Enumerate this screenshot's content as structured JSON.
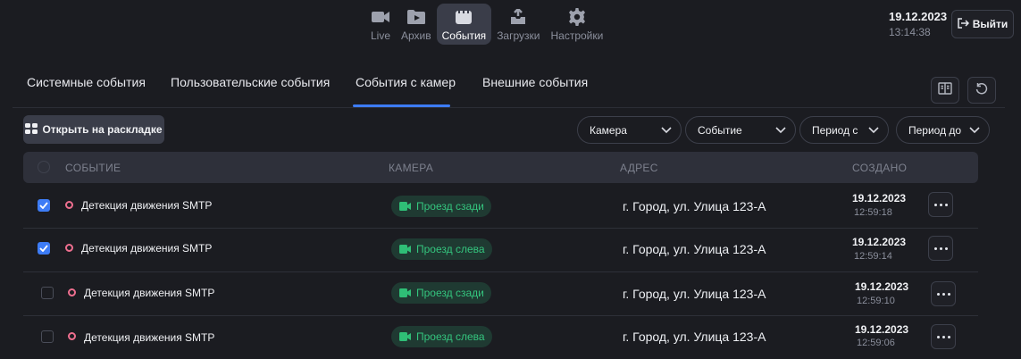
{
  "nav": {
    "items": [
      {
        "label": "Live",
        "icon": "camera-icon"
      },
      {
        "label": "Архив",
        "icon": "archive-folder-icon"
      },
      {
        "label": "События",
        "icon": "events-clapper-icon"
      },
      {
        "label": "Загрузки",
        "icon": "download-tray-icon"
      },
      {
        "label": "Настройки",
        "icon": "gear-icon"
      }
    ],
    "active_index": 2
  },
  "header": {
    "date": "19.12.2023",
    "time": "13:14:38",
    "logout_label": "Выйти"
  },
  "tabs": {
    "items": [
      "Системные события",
      "Пользовательские события",
      "События с камер",
      "Внешние события"
    ],
    "active_index": 2
  },
  "toolbar": {
    "open_layout_label": "Открыть на раскладке",
    "filters": {
      "camera": "Камера",
      "event": "Событие",
      "period_from": "Период с",
      "period_to": "Период до"
    }
  },
  "table": {
    "columns": {
      "event": "СОБЫТИЕ",
      "camera": "КАМЕРА",
      "address": "АДРЕС",
      "created": "СОЗДАНО"
    },
    "rows": [
      {
        "checked": true,
        "event": "Детекция движения SMTP",
        "camera": "Проезд сзади",
        "address": "г. Город, ул. Улица 123-А",
        "date": "19.12.2023",
        "time": "12:59:18"
      },
      {
        "checked": true,
        "event": "Детекция движения SMTP",
        "camera": "Проезд слева",
        "address": "г. Город, ул. Улица 123-А",
        "date": "19.12.2023",
        "time": "12:59:14"
      },
      {
        "checked": false,
        "event": "Детекция движения SMTP",
        "camera": "Проезд сзади",
        "address": "г. Город, ул. Улица 123-А",
        "date": "19.12.2023",
        "time": "12:59:10"
      },
      {
        "checked": false,
        "event": "Детекция движения SMTP",
        "camera": "Проезд слева",
        "address": "г. Город, ул. Улица 123-А",
        "date": "19.12.2023",
        "time": "12:59:06"
      }
    ]
  },
  "colors": {
    "background": "#1b1c21",
    "accent": "#3d7cf6",
    "camera_badge_text": "#34c57e",
    "event_dot": "#ee6f8f"
  }
}
